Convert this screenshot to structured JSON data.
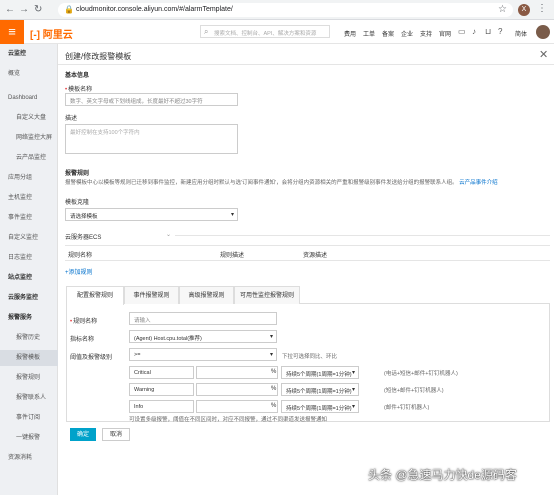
{
  "browser": {
    "url": "cloudmonitor.console.aliyun.com/#/alarmTemplate/",
    "profile_initial": "X"
  },
  "header": {
    "logo": "[-] 阿里云",
    "search_placeholder": "搜索文档、控制台、API、解决方案和资源",
    "nav": [
      "费用",
      "工单",
      "备案",
      "企业",
      "支持",
      "官网"
    ],
    "lang": "简体"
  },
  "sidebar": {
    "items": [
      {
        "label": "云监控",
        "level": 1,
        "bold": true,
        "active": false
      },
      {
        "label": "概览",
        "level": 1,
        "bold": false,
        "active": false
      },
      {
        "label": "Dashboard",
        "level": 1,
        "bold": false,
        "active": false
      },
      {
        "label": "自定义大盘",
        "level": 2,
        "bold": false,
        "active": false
      },
      {
        "label": "网络监控大屏",
        "level": 2,
        "bold": false,
        "active": false
      },
      {
        "label": "云产品监控",
        "level": 2,
        "bold": false,
        "active": false
      },
      {
        "label": "应用分组",
        "level": 1,
        "bold": false,
        "active": false
      },
      {
        "label": "主机监控",
        "level": 1,
        "bold": false,
        "active": false
      },
      {
        "label": "事件监控",
        "level": 1,
        "bold": false,
        "active": false
      },
      {
        "label": "自定义监控",
        "level": 1,
        "bold": false,
        "active": false
      },
      {
        "label": "日志监控",
        "level": 1,
        "bold": false,
        "active": false
      },
      {
        "label": "站点监控",
        "level": 1,
        "bold": true,
        "active": false
      },
      {
        "label": "云服务监控",
        "level": 1,
        "bold": true,
        "active": false
      },
      {
        "label": "报警服务",
        "level": 1,
        "bold": true,
        "active": false
      },
      {
        "label": "报警历史",
        "level": 2,
        "bold": false,
        "active": false
      },
      {
        "label": "报警模板",
        "level": 2,
        "bold": false,
        "active": true
      },
      {
        "label": "报警规则",
        "level": 2,
        "bold": false,
        "active": false
      },
      {
        "label": "报警联系人",
        "level": 2,
        "bold": false,
        "active": false
      },
      {
        "label": "事件订阅",
        "level": 2,
        "bold": false,
        "active": false
      },
      {
        "label": "一键报警",
        "level": 2,
        "bold": false,
        "active": false
      },
      {
        "label": "资源消耗",
        "level": 1,
        "bold": false,
        "active": false
      }
    ]
  },
  "panel": {
    "title": "创建/修改报警模板",
    "basic_info": "基本信息",
    "name_label": "模板名称",
    "name_placeholder": "数字、英文字母或下划线组成，长度最好不超过30字符",
    "desc_label": "描述",
    "desc_placeholder": "最好控制在支持100个字符内",
    "alarm_rules": "报警规则",
    "alarm_rules_desc": "报警模板中心以模板等规则已迁移到事件监控，新建应用分组时默认与选'订阅事件通知'，会将分组内资源相关的严重和报警级别事件发送给分组的报警联系人组。",
    "alarm_rules_link": "云产品事件介绍",
    "clone_label": "模板克隆",
    "clone_select": "请选择模板",
    "service_label": "云服务器ECS",
    "table_headers": [
      "规则名称",
      "规则描述",
      "资源描述"
    ],
    "add_rule": "+添加规则",
    "tabs": [
      "配置报警规则",
      "事件报警规则",
      "高级报警规则",
      "可用性监控报警规则"
    ],
    "rule_name_label": "规则名称",
    "rule_name_placeholder": "请输入",
    "metric_label": "指标名称",
    "metric_value": "(Agent) Host.cpu.total(推荐)",
    "threshold_label": "阈值及报警级别",
    "comparator": ">=",
    "comparator_hint": "下拉可选择同比、环比",
    "levels": [
      {
        "level": "Critical",
        "unit": "%",
        "period": "持续5个周期(1周期=1分钟)",
        "notify": "(电话+短信+邮件+钉钉机器人)"
      },
      {
        "level": "Warning",
        "unit": "%",
        "period": "持续5个周期(1周期=1分钟)",
        "notify": "(短信+邮件+钉钉机器人)"
      },
      {
        "level": "Info",
        "unit": "%",
        "period": "持续5个周期(1周期=1分钟)",
        "notify": "(邮件+钉钉机器人)"
      }
    ],
    "levels_hint": "可设置多级报警，阈值在不同区间时，对应不同报警，通过不同渠道发送报警通知",
    "ok_button": "确定",
    "cancel_button": "取消"
  },
  "watermark": "头条 @急速马力快de源码客"
}
